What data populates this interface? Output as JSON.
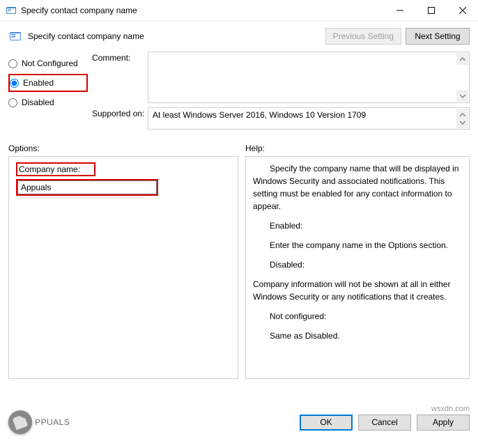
{
  "titlebar": {
    "title": "Specify contact company name"
  },
  "header": {
    "title": "Specify contact company name",
    "prev": "Previous Setting",
    "next": "Next Setting"
  },
  "radios": {
    "not_configured": "Not Configured",
    "enabled": "Enabled",
    "disabled": "Disabled"
  },
  "labels": {
    "comment": "Comment:",
    "supported": "Supported on:",
    "options": "Options:",
    "help": "Help:"
  },
  "supported_text": "At least Windows Server 2016, Windows 10 Version 1709",
  "options": {
    "company_label": "Company name:",
    "company_value": "Appuals"
  },
  "help": {
    "p1": "Specify the company name that will be displayed in Windows Security and associated notifications. This setting must be enabled for any contact information to appear.",
    "h_enabled": "Enabled:",
    "p_enabled": "Enter the company name in the Options section.",
    "h_disabled": "Disabled:",
    "p_disabled": "Company information will not be shown at all in either Windows Security or any notifications that it creates.",
    "h_nc": "Not configured:",
    "p_nc": "Same as Disabled."
  },
  "footer": {
    "ok": "OK",
    "cancel": "Cancel",
    "apply": "Apply"
  },
  "watermark": {
    "text": "PPUALS",
    "url": "wsxdn.com"
  }
}
